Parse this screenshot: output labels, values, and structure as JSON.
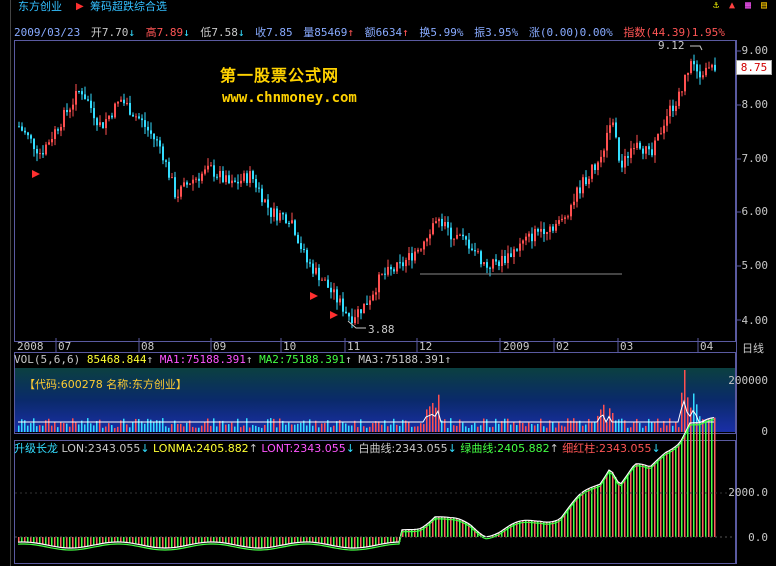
{
  "toolbar": {
    "stock_name": "东方创业",
    "indicator_name": "筹码超跌综合选",
    "arrow": "▶"
  },
  "info": {
    "date": "2009/03/23",
    "open": "开7.70",
    "open_arrow": "↓",
    "high": "高7.89",
    "high_arrow": "↓",
    "low": "低7.58",
    "low_arrow": "↓",
    "close": "收7.85",
    "volume": "量85469",
    "vol_arrow": "↑",
    "amount": "额6634",
    "amount_arrow": "↑",
    "turnover": "换5.99%",
    "amplitude": "振3.95%",
    "change": "涨(0.00)0.00%",
    "index": "指数(44.39)1.95%"
  },
  "watermark": {
    "line1": "第一股票公式网",
    "line2": "www.chnmoney.com"
  },
  "price_axis": {
    "labels": [
      "9.00",
      "8.00",
      "7.00",
      "6.00",
      "5.00",
      "4.00"
    ],
    "current": "8.75",
    "high_mark": "9.12",
    "low_mark": "3.88"
  },
  "time_axis": {
    "labels": [
      "2008",
      "07",
      "08",
      "09",
      "10",
      "11",
      "12",
      "2009",
      "02",
      "03",
      "04"
    ],
    "period": "日线"
  },
  "volume_panel": {
    "title": "VOL(5,6,6)",
    "value": "85468.844",
    "value_arrow": "↑",
    "ma1": "MA1:75188.391",
    "ma1_arrow": "↑",
    "ma2": "MA2:75188.391",
    "ma2_arrow": "↑",
    "ma3": "MA3:75188.391",
    "ma3_arrow": "↑",
    "code_label": "【代码:600278 名称:东方创业】",
    "axis_labels": [
      "200000",
      "0"
    ]
  },
  "indicator_panel": {
    "title": "升级长龙",
    "lon": "LON:2343.055",
    "lon_arrow": "↓",
    "lonma": "LONMA:2405.882",
    "lonma_arrow": "↑",
    "lont": "LONT:2343.055",
    "lont_arrow": "↓",
    "white": "白曲线:2343.055",
    "white_arrow": "↓",
    "green": "绿曲线:2405.882",
    "green_arrow": "↑",
    "red": "细红柱:2343.055",
    "red_arrow": "↓",
    "axis_labels": [
      "2000.0",
      "0.0"
    ]
  },
  "colors": {
    "up": "#ff5050",
    "down": "#33ddff",
    "frame": "#5a5aa0",
    "watermark": "#ffd200"
  },
  "toolbar_icons": [
    "lock-icon",
    "up-icon",
    "scale-icon",
    "settings-icon"
  ]
}
